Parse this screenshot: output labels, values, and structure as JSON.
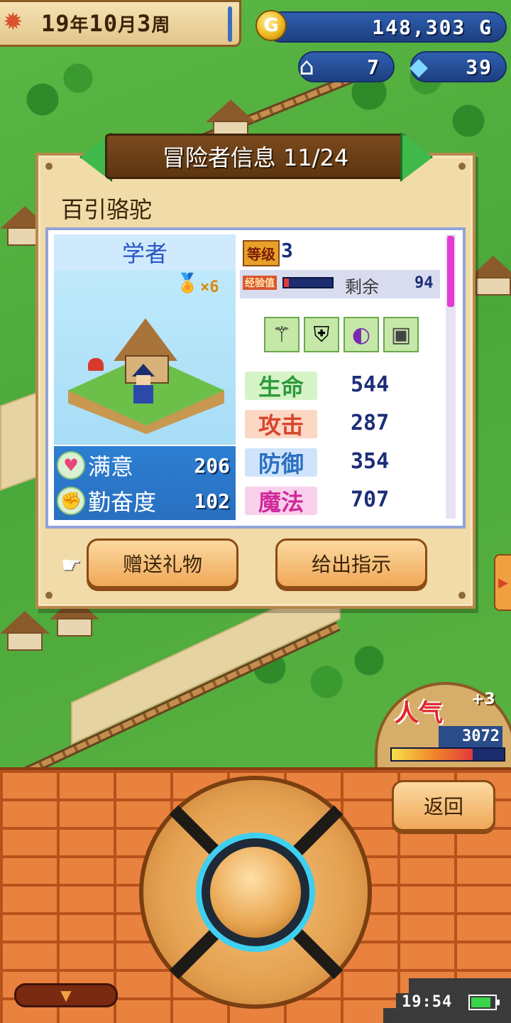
{
  "hud": {
    "year": "19",
    "year_unit": "年",
    "month": "10",
    "month_unit": "月",
    "week": "3",
    "week_unit": "周",
    "coin_symbol": "G",
    "gold": "148,303 G",
    "buildings": "7",
    "crystals": "39"
  },
  "dialog": {
    "title": "冒险者信息 11/24",
    "adventurer_name": "百引骆驼",
    "class_name": "学者",
    "medal_count": "×6",
    "level_label": "等级",
    "level": "3",
    "exp_label": "经验值",
    "exp_fraction": 0.1,
    "remain_label": "剩余",
    "remain_value": "94",
    "equipment_icons": [
      "staff-icon",
      "armor-icon",
      "witch-hat-icon",
      "accessory-icon"
    ],
    "mood": [
      {
        "icon": "heart-icon",
        "label": "满意",
        "value": "206"
      },
      {
        "icon": "diligence-icon",
        "label": "勤奋度",
        "value": "102"
      }
    ],
    "stats": [
      {
        "label": "生命",
        "value": "544",
        "color": "#2e9a3a",
        "bg": "#d6f3c8"
      },
      {
        "label": "攻击",
        "value": "287",
        "color": "#d9442a",
        "bg": "#fbd7c4"
      },
      {
        "label": "防御",
        "value": "354",
        "color": "#2a6fc0",
        "bg": "#cfe4fb"
      },
      {
        "label": "魔法",
        "value": "707",
        "color": "#d02a9a",
        "bg": "#f9d0ec"
      }
    ],
    "gift_button": "赠送礼物",
    "instruct_button": "给出指示"
  },
  "popularity": {
    "label": "人气",
    "plus": "+3",
    "value": "3072",
    "fraction": 0.72
  },
  "controls": {
    "back_button": "返回",
    "collapse_symbol": "▼"
  },
  "status": {
    "time": "19:54",
    "battery_fraction": 0.85
  },
  "colors": {
    "accent_blue": "#2a6fc0",
    "panel_tan": "#f1dba8",
    "brick": "#e8823e"
  }
}
